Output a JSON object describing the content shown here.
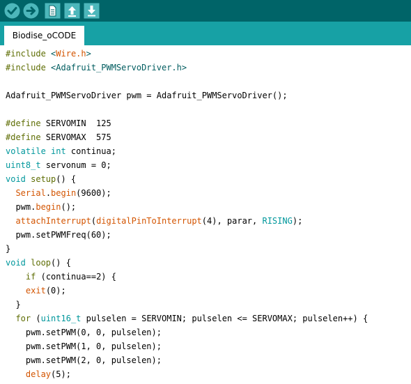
{
  "colors": {
    "toolbar_bg": "#006468",
    "tabbar_bg": "#17a1a5",
    "button_bg": "#4db7bb",
    "preprocessor": "#5e6d03",
    "string": "#005c5f",
    "keyword_type": "#00979c",
    "function": "#d35400",
    "text": "#000000"
  },
  "toolbar": {
    "buttons": [
      {
        "name": "verify-button",
        "icon": "check-icon"
      },
      {
        "name": "upload-button",
        "icon": "arrow-right-icon"
      },
      {
        "name": "new-button",
        "icon": "new-file-icon"
      },
      {
        "name": "open-button",
        "icon": "open-up-arrow-icon"
      },
      {
        "name": "save-button",
        "icon": "save-down-arrow-icon"
      }
    ]
  },
  "tabs": {
    "active_label": "Biodise_oCODE"
  },
  "editor": {
    "lines": [
      [
        {
          "t": "#include ",
          "c": "pre"
        },
        {
          "t": "<",
          "c": "str"
        },
        {
          "t": "Wire.h",
          "c": "fn"
        },
        {
          "t": ">",
          "c": "str"
        }
      ],
      [
        {
          "t": "#include ",
          "c": "pre"
        },
        {
          "t": "<Adafruit_PWMServoDriver.h>",
          "c": "str"
        }
      ],
      [],
      [
        {
          "t": "Adafruit_PWMServoDriver pwm = Adafruit_PWMServoDriver();",
          "c": "plain"
        }
      ],
      [],
      [
        {
          "t": "#define ",
          "c": "pre"
        },
        {
          "t": "SERVOMIN  125",
          "c": "plain"
        }
      ],
      [
        {
          "t": "#define ",
          "c": "pre"
        },
        {
          "t": "SERVOMAX  575",
          "c": "plain"
        }
      ],
      [
        {
          "t": "volatile int ",
          "c": "type"
        },
        {
          "t": "continua;",
          "c": "plain"
        }
      ],
      [
        {
          "t": "uint8_t ",
          "c": "type"
        },
        {
          "t": "servonum = 0;",
          "c": "plain"
        }
      ],
      [
        {
          "t": "void ",
          "c": "type"
        },
        {
          "t": "setup",
          "c": "pre"
        },
        {
          "t": "() {",
          "c": "plain"
        }
      ],
      [
        {
          "t": "  ",
          "c": "plain"
        },
        {
          "t": "Serial",
          "c": "fn"
        },
        {
          "t": ".",
          "c": "plain"
        },
        {
          "t": "begin",
          "c": "fn"
        },
        {
          "t": "(9600);",
          "c": "plain"
        }
      ],
      [
        {
          "t": "  pwm.",
          "c": "plain"
        },
        {
          "t": "begin",
          "c": "fn"
        },
        {
          "t": "();",
          "c": "plain"
        }
      ],
      [
        {
          "t": "  ",
          "c": "plain"
        },
        {
          "t": "attachInterrupt",
          "c": "fn"
        },
        {
          "t": "(",
          "c": "plain"
        },
        {
          "t": "digitalPinToInterrupt",
          "c": "fn"
        },
        {
          "t": "(4), parar, ",
          "c": "plain"
        },
        {
          "t": "RISING",
          "c": "type"
        },
        {
          "t": ");",
          "c": "plain"
        }
      ],
      [
        {
          "t": "  pwm.setPWMFreq(60);",
          "c": "plain"
        }
      ],
      [
        {
          "t": "}",
          "c": "plain"
        }
      ],
      [
        {
          "t": "void ",
          "c": "type"
        },
        {
          "t": "loop",
          "c": "pre"
        },
        {
          "t": "() {",
          "c": "plain"
        }
      ],
      [
        {
          "t": "    ",
          "c": "plain"
        },
        {
          "t": "if ",
          "c": "pre"
        },
        {
          "t": "(continua==2) {",
          "c": "plain"
        }
      ],
      [
        {
          "t": "    ",
          "c": "plain"
        },
        {
          "t": "exit",
          "c": "fn"
        },
        {
          "t": "(0);",
          "c": "plain"
        }
      ],
      [
        {
          "t": "  }",
          "c": "plain"
        }
      ],
      [
        {
          "t": "  ",
          "c": "plain"
        },
        {
          "t": "for ",
          "c": "pre"
        },
        {
          "t": "(",
          "c": "plain"
        },
        {
          "t": "uint16_t ",
          "c": "type"
        },
        {
          "t": "pulselen = SERVOMIN; pulselen <= SERVOMAX; pulselen++) {",
          "c": "plain"
        }
      ],
      [
        {
          "t": "    pwm.setPWM(0, 0, pulselen);",
          "c": "plain"
        }
      ],
      [
        {
          "t": "    pwm.setPWM(1, 0, pulselen);",
          "c": "plain"
        }
      ],
      [
        {
          "t": "    pwm.setPWM(2, 0, pulselen);",
          "c": "plain"
        }
      ],
      [
        {
          "t": "    ",
          "c": "plain"
        },
        {
          "t": "delay",
          "c": "fn"
        },
        {
          "t": "(5);",
          "c": "plain"
        }
      ]
    ]
  }
}
